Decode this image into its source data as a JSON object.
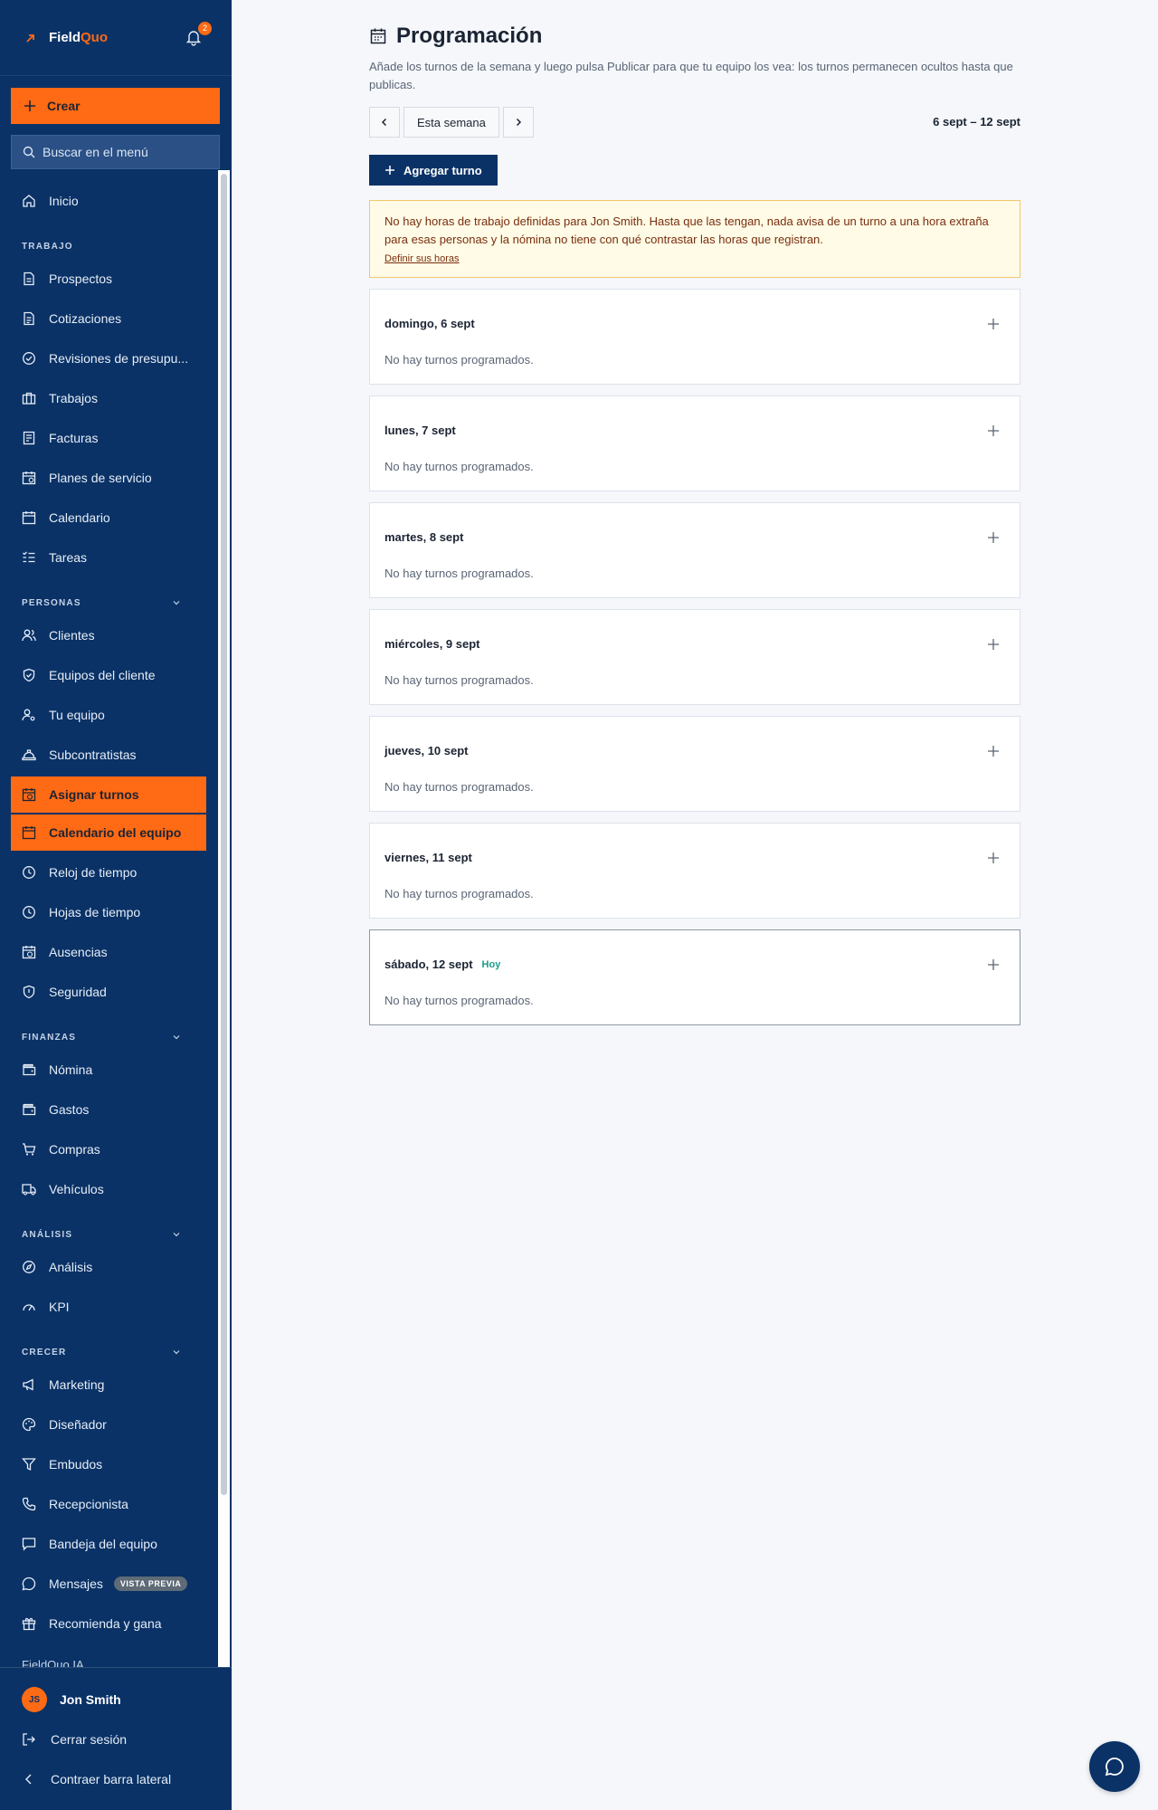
{
  "brand": {
    "part1": "Field",
    "part2": "Quo"
  },
  "notifications": {
    "count": "2"
  },
  "sidebar": {
    "create_label": "Crear",
    "search_placeholder": "Buscar en el menú",
    "home": "Inicio",
    "sections": {
      "trabajo": "TRABAJO",
      "personas": "PERSONAS",
      "finanzas": "FINANZAS",
      "analisis": "ANÁLISIS",
      "crecer": "CRECER"
    },
    "trabajo_items": [
      "Prospectos",
      "Cotizaciones",
      "Revisiones de presupu...",
      "Trabajos",
      "Facturas",
      "Planes de servicio",
      "Calendario",
      "Tareas"
    ],
    "personas_items": [
      "Clientes",
      "Equipos del cliente",
      "Tu equipo",
      "Subcontratistas",
      "Asignar turnos",
      "Calendario del equipo",
      "Reloj de tiempo",
      "Hojas de tiempo",
      "Ausencias",
      "Seguridad"
    ],
    "finanzas_items": [
      "Nómina",
      "Gastos",
      "Compras",
      "Vehículos"
    ],
    "analisis_items": [
      "Análisis",
      "KPI"
    ],
    "crecer_items": [
      "Marketing",
      "Diseñador",
      "Embudos",
      "Recepcionista",
      "Bandeja del equipo",
      "Mensajes",
      "Recomienda y gana"
    ],
    "preview_badge": "VISTA PREVIA",
    "ai_item": "FieldQuo IA",
    "user": {
      "initials": "JS",
      "name": "Jon Smith"
    },
    "logout": "Cerrar sesión",
    "collapse": "Contraer barra lateral"
  },
  "main": {
    "title": "Programación",
    "subtitle": "Añade los turnos de la semana y luego pulsa Publicar para que tu equipo los vea: los turnos permanecen ocultos hasta que publicas.",
    "this_week": "Esta semana",
    "range": "6 sept – 12 sept",
    "add_shift": "Agregar turno",
    "warning": {
      "text": "No hay horas de trabajo definidas para Jon Smith. Hasta que las tengan, nada avisa de un turno a una hora extraña para esas personas y la nómina no tiene con qué contrastar las horas que registran.",
      "link": "Definir sus horas"
    },
    "empty_text": "No hay turnos programados.",
    "today_label": "Hoy",
    "days": [
      "domingo, 6 sept",
      "lunes, 7 sept",
      "martes, 8 sept",
      "miércoles, 9 sept",
      "jueves, 10 sept",
      "viernes, 11 sept",
      "sábado, 12 sept"
    ]
  },
  "colors": {
    "sidebar": "#0a3266",
    "accent": "#ff6a14",
    "today": "#1a9c8b",
    "warning_bg": "#fffbe6"
  }
}
